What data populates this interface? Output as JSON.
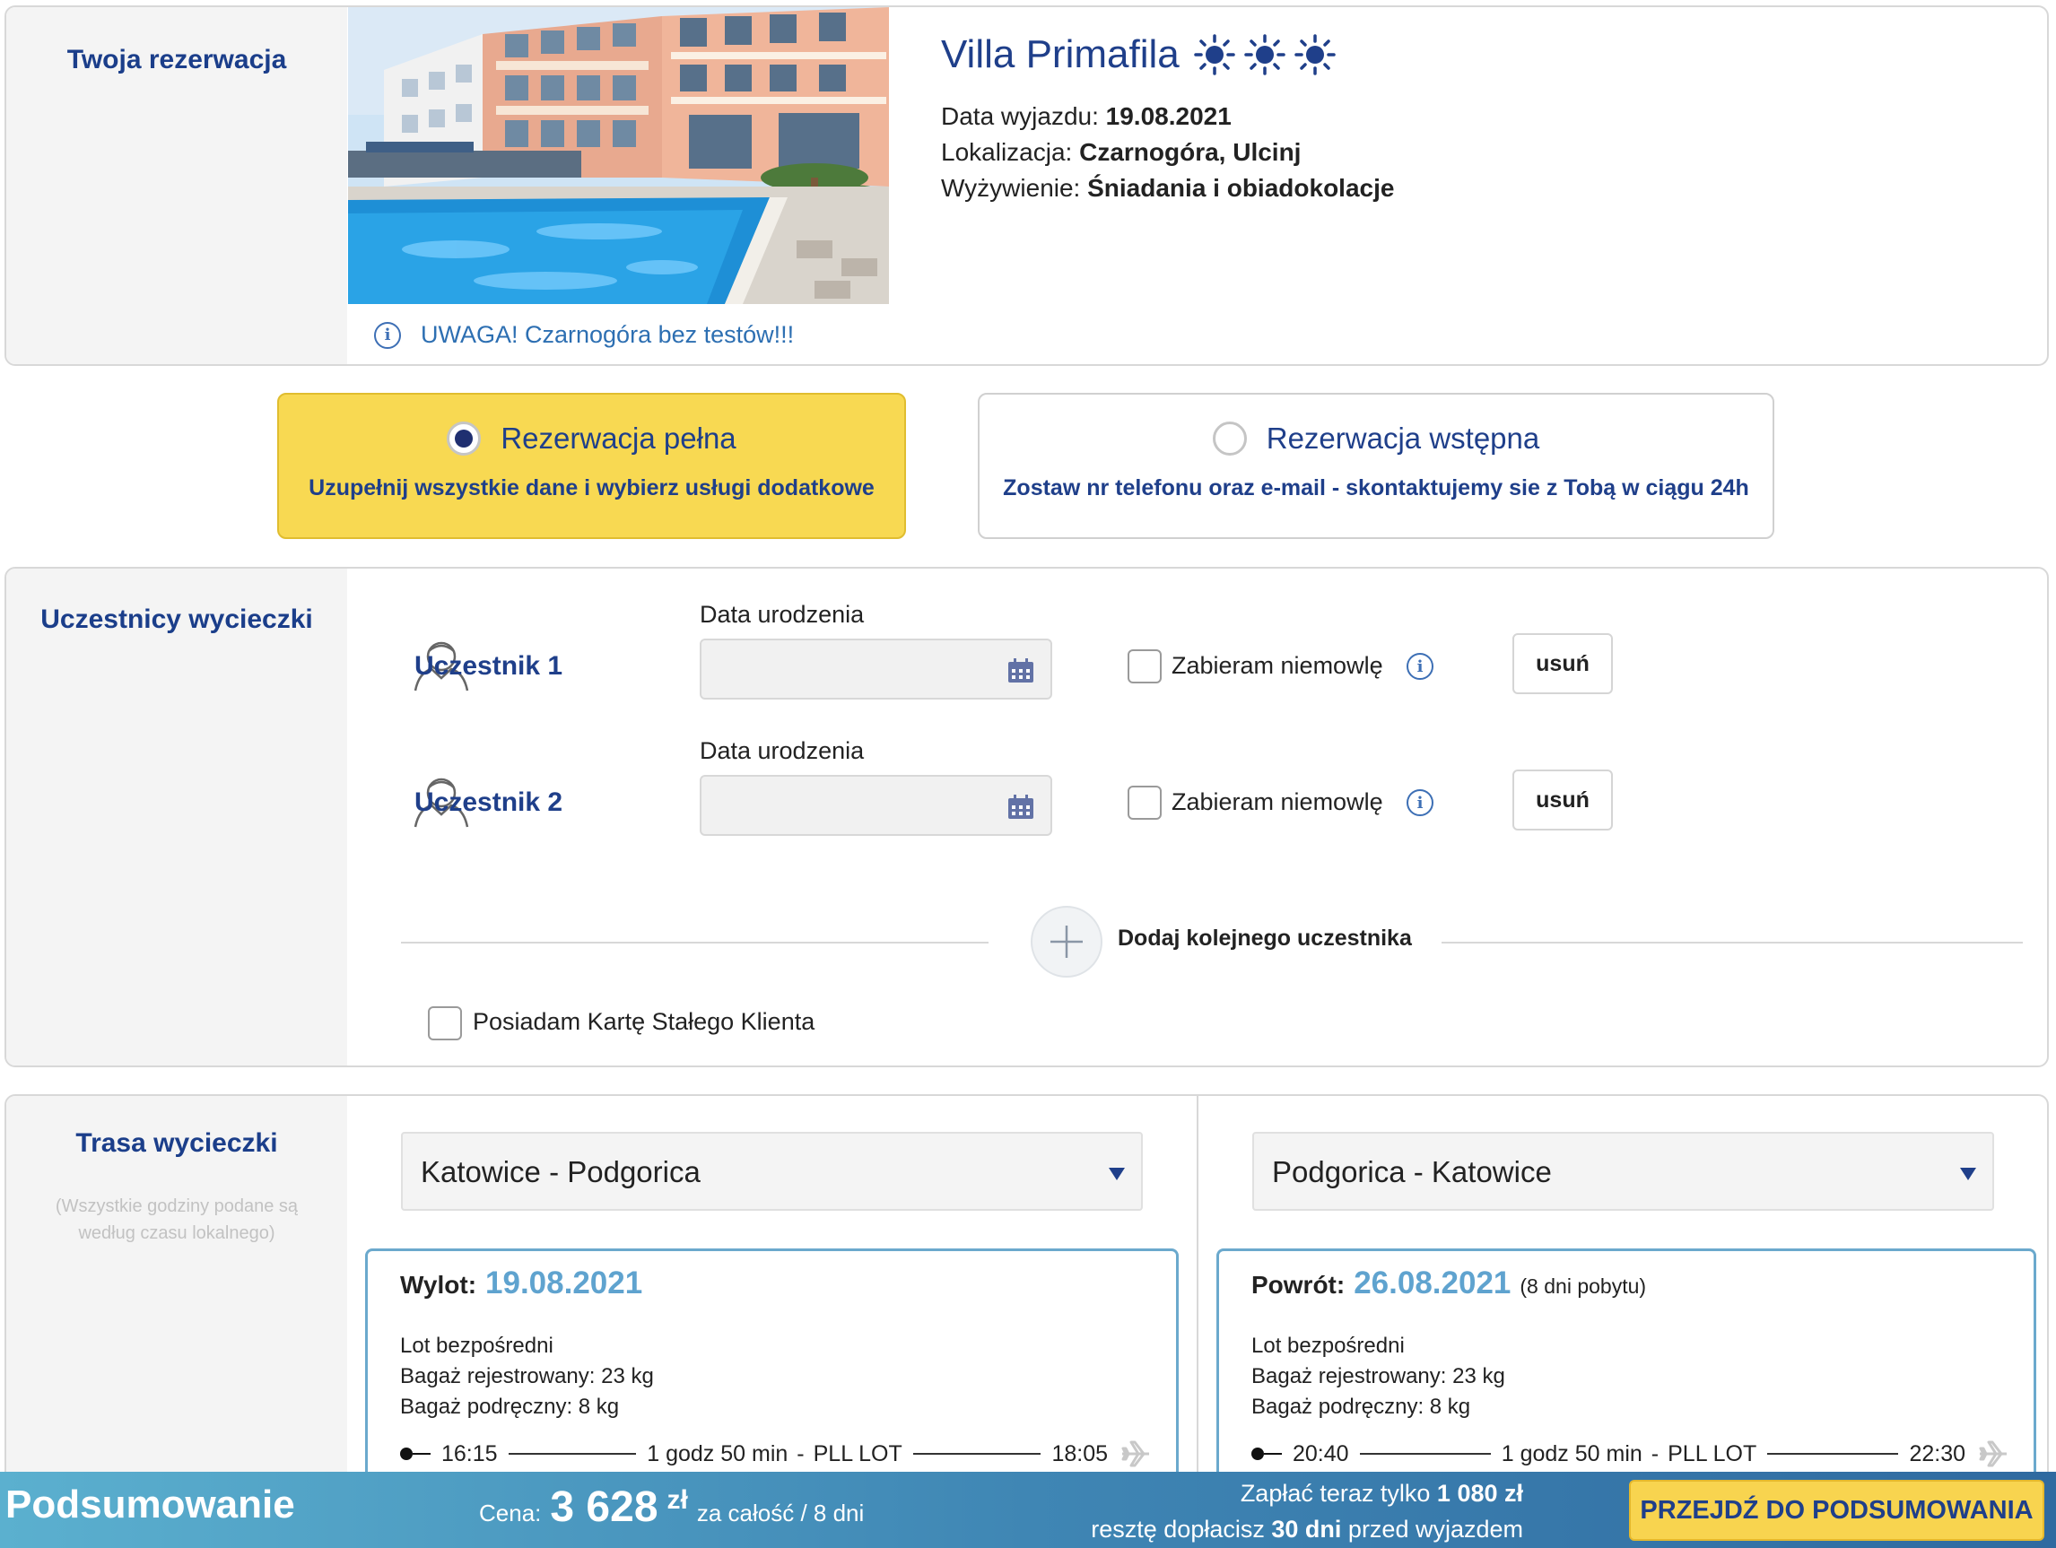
{
  "booking": {
    "section_title": "Twoja rezerwacja",
    "hotel_name": "Villa Primafila",
    "rating_icons": [
      "sun-icon",
      "sun-icon",
      "sun-icon"
    ],
    "departure_label": "Data wyjazdu:",
    "departure_value": "19.08.2021",
    "location_label": "Lokalizacja:",
    "location_value": "Czarnogóra, Ulcinj",
    "meals_label": "Wyżywienie:",
    "meals_value": "Śniadania i obiadokolacje",
    "notice": "UWAGA! Czarnogóra bez testów!!!"
  },
  "reservation_types": {
    "full": {
      "title": "Rezerwacja pełna",
      "subtitle": "Uzupełnij wszystkie dane i wybierz usługi dodatkowe",
      "selected": true
    },
    "preliminary": {
      "title": "Rezerwacja wstępna",
      "subtitle": "Zostaw nr telefonu oraz e-mail - skontaktujemy sie z Tobą w ciągu 24h",
      "selected": false
    }
  },
  "participants": {
    "section_title": "Uczestnicy wycieczki",
    "items": [
      {
        "name": "Uczestnik 1",
        "dob_label": "Data urodzenia",
        "dob_value": "",
        "infant_label": "Zabieram niemowlę",
        "remove_label": "usuń"
      },
      {
        "name": "Uczestnik 2",
        "dob_label": "Data urodzenia",
        "dob_value": "",
        "infant_label": "Zabieram niemowlę",
        "remove_label": "usuń"
      }
    ],
    "add_label": "Dodaj kolejnego uczestnika",
    "loyalty_label": "Posiadam Kartę Stałego Klienta"
  },
  "route": {
    "section_title": "Trasa wycieczki",
    "note": "(Wszystkie godziny podane są według czasu lokalnego)",
    "outbound": {
      "select_value": "Katowice - Podgorica",
      "head_label": "Wylot:",
      "date": "19.08.2021",
      "extra": "",
      "type": "Lot bezpośredni",
      "checked_baggage": "Bagaż rejestrowany: 23 kg",
      "hand_baggage": "Bagaż podręczny: 8 kg",
      "dep_time": "16:15",
      "duration": "1 godz 50 min",
      "airline": "PLL LOT",
      "arr_time": "18:05"
    },
    "return": {
      "select_value": "Podgorica - Katowice",
      "head_label": "Powrót:",
      "date": "26.08.2021",
      "extra": "(8 dni pobytu)",
      "type": "Lot bezpośredni",
      "checked_baggage": "Bagaż rejestrowany: 23 kg",
      "hand_baggage": "Bagaż podręczny: 8 kg",
      "dep_time": "20:40",
      "duration": "1 godz 50 min",
      "airline": "PLL LOT",
      "arr_time": "22:30"
    }
  },
  "summary": {
    "title": "Podsumowanie",
    "price_label": "Cena:",
    "price_value": "3 628",
    "currency": "zł",
    "price_suffix": "za całość / 8 dni",
    "pay_now_prefix": "Zapłać teraz tylko",
    "pay_now_amount": "1 080 zł",
    "pay_rest_prefix": "resztę dopłacisz",
    "pay_rest_days": "30 dni",
    "pay_rest_suffix": "przed wyjazdem",
    "cta_label": "PRZEJDŹ DO PODSUMOWANIA"
  },
  "colors": {
    "brand_navy": "#1f3f8a",
    "accent_yellow": "#f8d952",
    "date_blue": "#5fa3cf"
  }
}
